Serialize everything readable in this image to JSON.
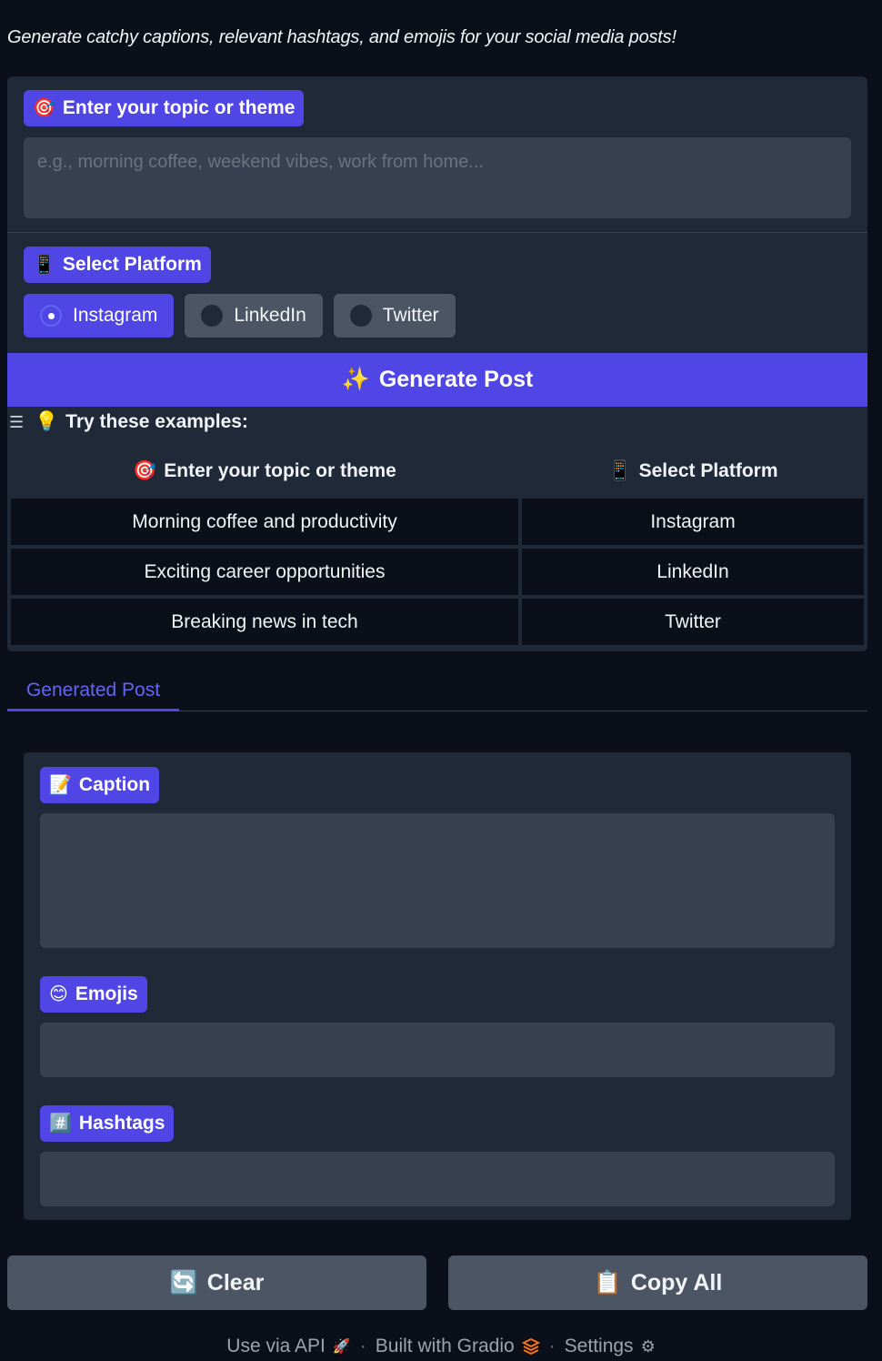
{
  "subtitle": "Generate catchy captions, relevant hashtags, and emojis for your social media posts!",
  "topic": {
    "icon": "🎯",
    "label": "Enter your topic or theme",
    "placeholder": "e.g., morning coffee, weekend vibes, work from home...",
    "value": ""
  },
  "platform": {
    "icon": "📱",
    "label": "Select Platform",
    "options": [
      "Instagram",
      "LinkedIn",
      "Twitter"
    ],
    "selected": "Instagram"
  },
  "generate_button": {
    "icon": "✨",
    "label": "Generate Post"
  },
  "examples": {
    "icon": "💡",
    "title": "Try these examples:",
    "headers": [
      {
        "icon": "🎯",
        "label": "Enter your topic or theme"
      },
      {
        "icon": "📱",
        "label": "Select Platform"
      }
    ],
    "rows": [
      [
        "Morning coffee and productivity",
        "Instagram"
      ],
      [
        "Exciting career opportunities",
        "LinkedIn"
      ],
      [
        "Breaking news in tech",
        "Twitter"
      ]
    ]
  },
  "tabs": {
    "active": "Generated Post"
  },
  "outputs": {
    "caption": {
      "icon": "📝",
      "label": "Caption",
      "value": ""
    },
    "emojis": {
      "icon": "😊",
      "label": "Emojis",
      "value": ""
    },
    "hashtags": {
      "icon": "#️⃣",
      "label": "Hashtags",
      "value": ""
    }
  },
  "actions": {
    "clear": {
      "icon": "🔄",
      "label": "Clear"
    },
    "copy": {
      "icon": "📋",
      "label": "Copy All"
    }
  },
  "footer": {
    "api": "Use via API",
    "built": "Built with Gradio",
    "settings": "Settings"
  },
  "colors": {
    "accent": "#4f46e5",
    "background": "#0b0f19",
    "panel": "#1f2937",
    "field": "#374151"
  }
}
